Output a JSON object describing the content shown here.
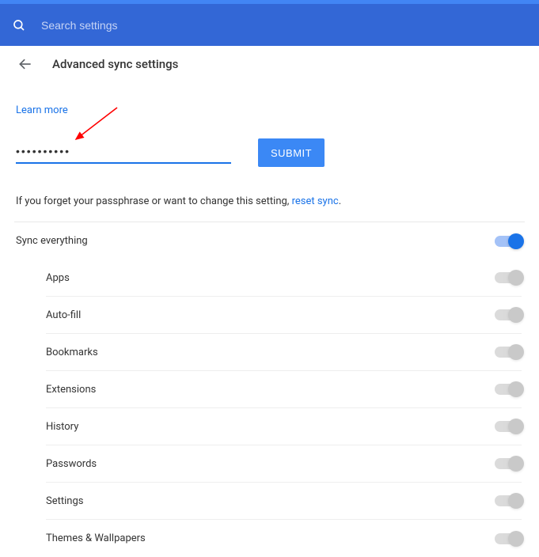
{
  "search": {
    "placeholder": "Search settings"
  },
  "header": {
    "title": "Advanced sync settings"
  },
  "learn_more": "Learn more",
  "passphrase": {
    "value": "••••••••••"
  },
  "submit_label": "SUBMIT",
  "forget_text": "If you forget your passphrase or want to change this setting, ",
  "reset_link": "reset sync",
  "forget_period": ".",
  "sync_everything_label": "Sync everything",
  "items": [
    {
      "label": "Apps"
    },
    {
      "label": "Auto-fill"
    },
    {
      "label": "Bookmarks"
    },
    {
      "label": "Extensions"
    },
    {
      "label": "History"
    },
    {
      "label": "Passwords"
    },
    {
      "label": "Settings"
    },
    {
      "label": "Themes & Wallpapers"
    }
  ]
}
